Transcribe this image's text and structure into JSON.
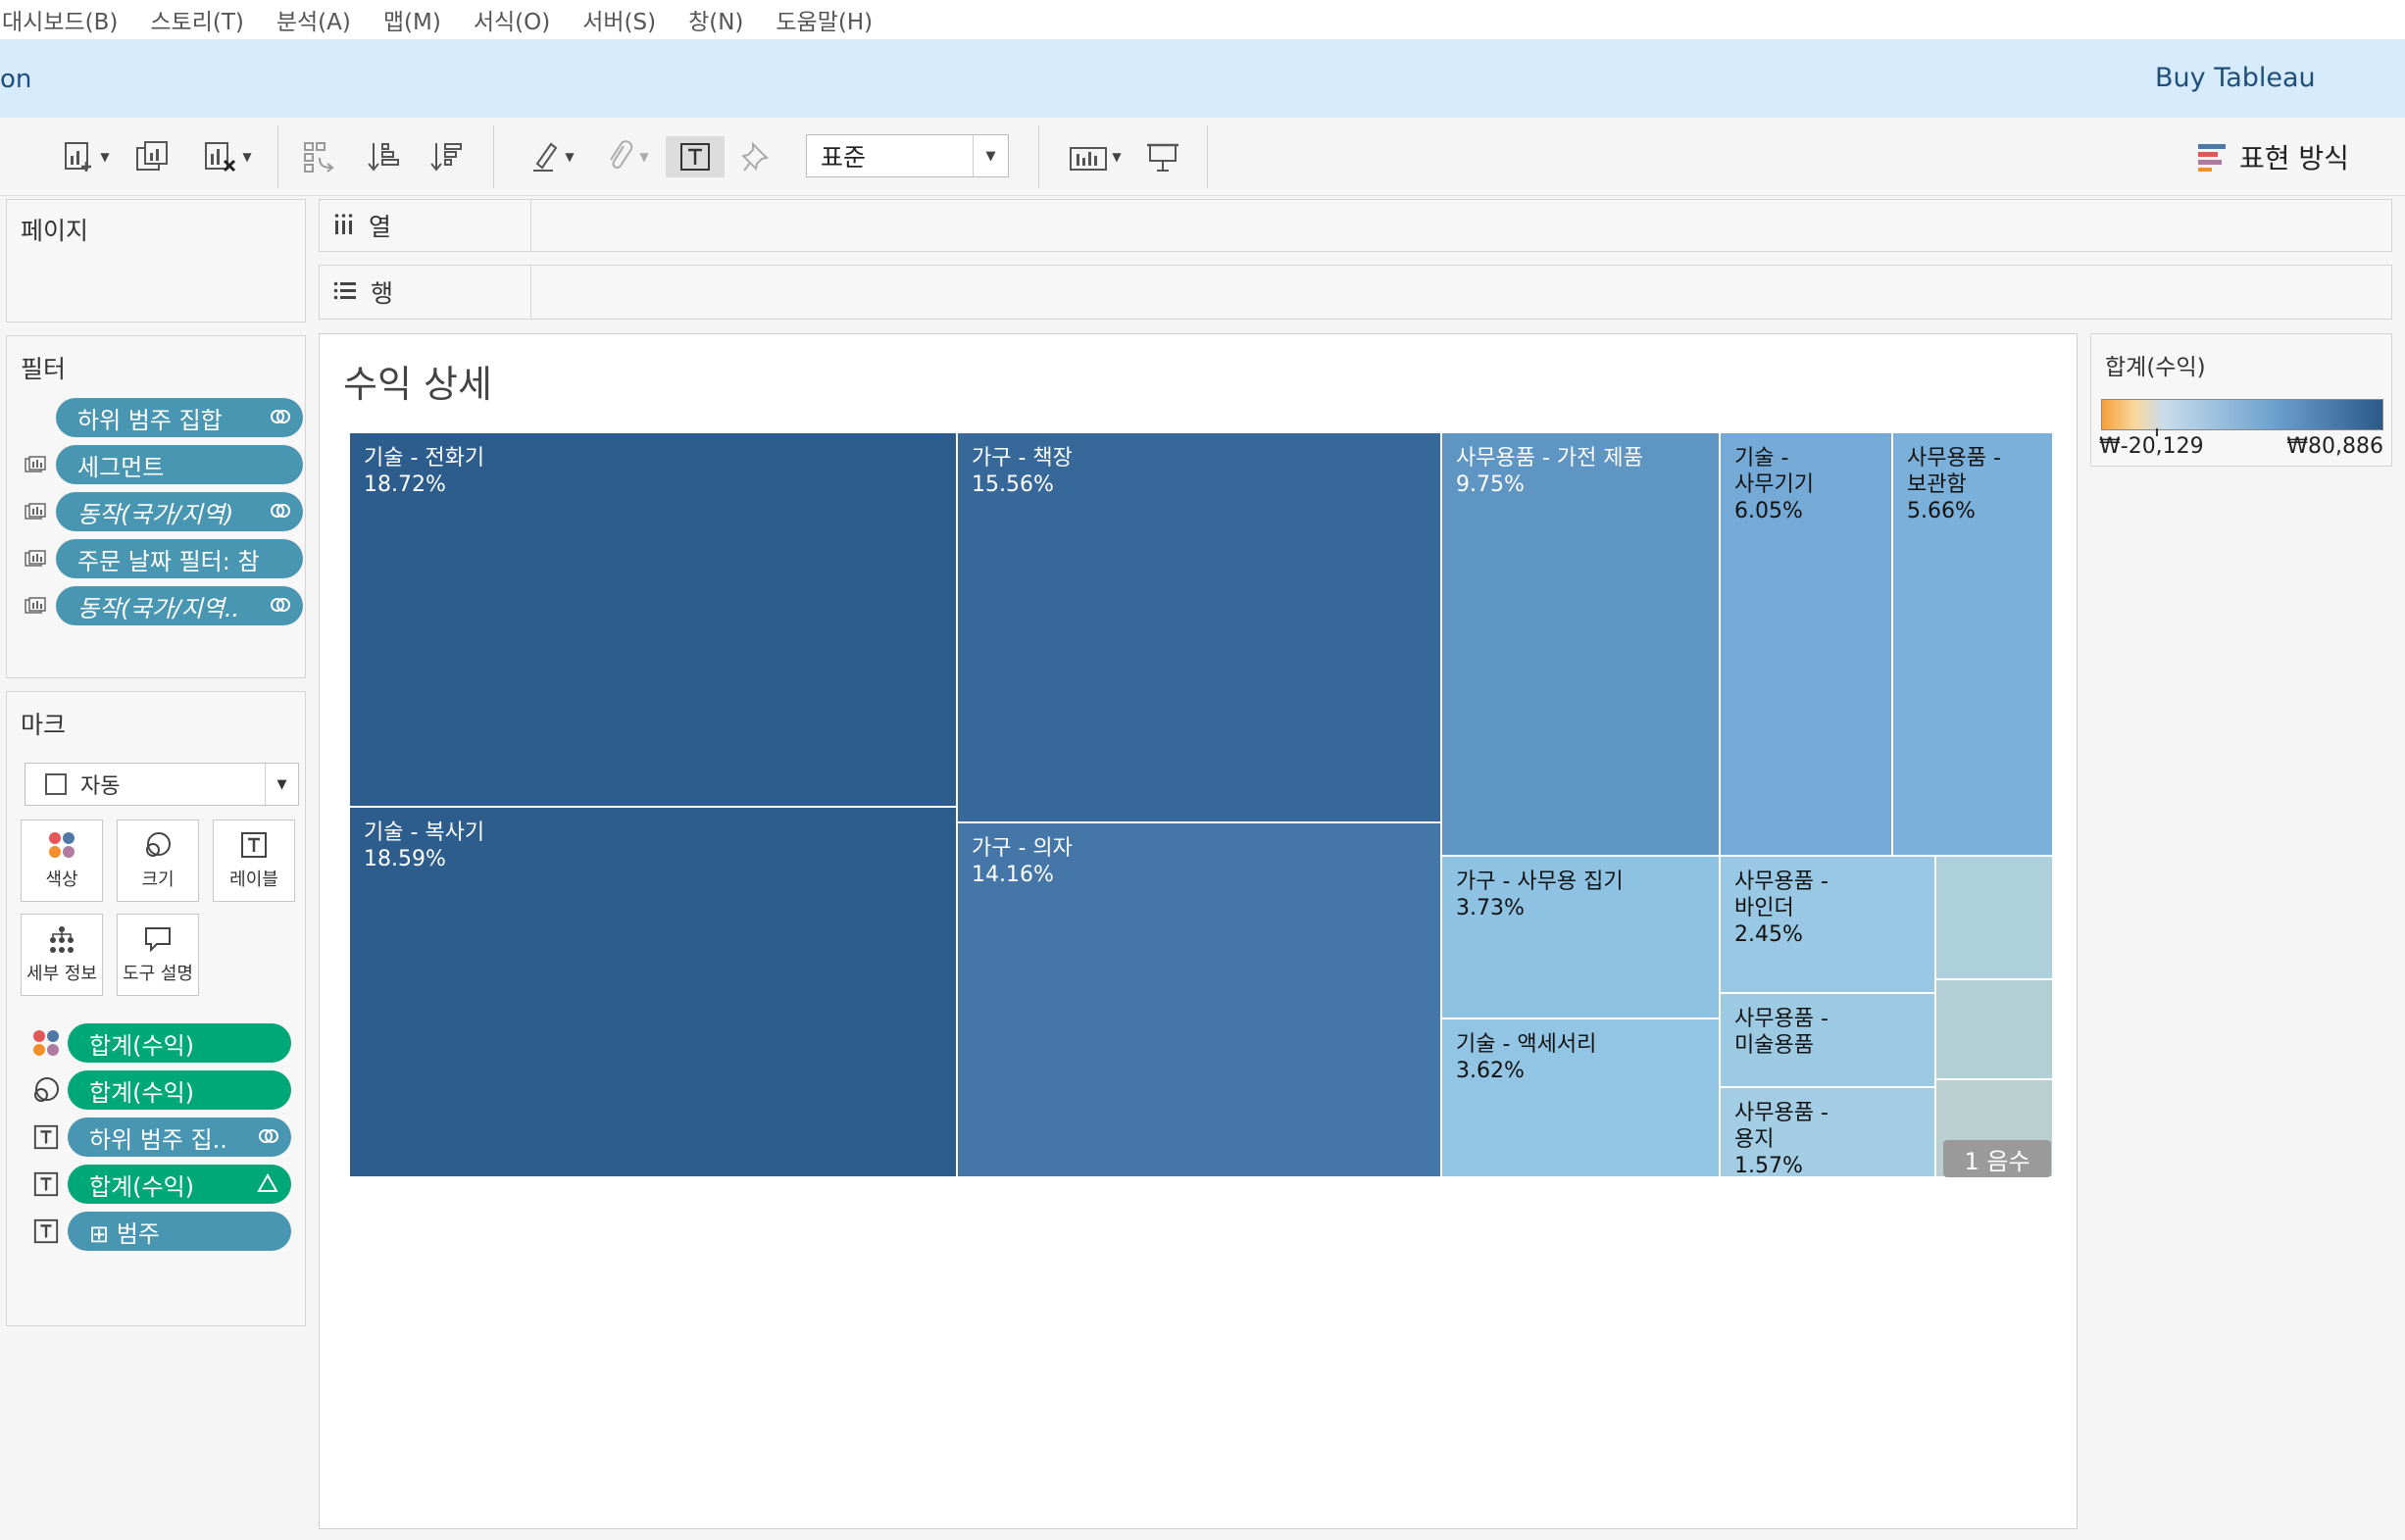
{
  "menu": [
    "대시보드(B)",
    "스토리(T)",
    "분석(A)",
    "맵(M)",
    "서식(O)",
    "서버(S)",
    "창(N)",
    "도움말(H)"
  ],
  "banner": {
    "title_fragment": "on",
    "buy": "Buy Tableau"
  },
  "toolbar": {
    "fit_value": "표준",
    "show_me": "표현 방식"
  },
  "pages": {
    "title": "페이지"
  },
  "columns": {
    "label": "열"
  },
  "rows": {
    "label": "행"
  },
  "filters": {
    "title": "필터",
    "items": [
      {
        "label": "하위 범주 집합",
        "italic": false,
        "icon": "set-icon"
      },
      {
        "label": "세그먼트",
        "italic": false,
        "icon": ""
      },
      {
        "label": "동작(국가/지역)",
        "italic": true,
        "icon": "set-icon"
      },
      {
        "label": "주문 날짜 필터: 참",
        "italic": false,
        "icon": ""
      },
      {
        "label": "동작(국가/지역..",
        "italic": true,
        "icon": "set-icon"
      }
    ]
  },
  "marks": {
    "title": "마크",
    "type": "자동",
    "buttons": [
      "색상",
      "크기",
      "레이블",
      "세부 정보",
      "도구 설명"
    ],
    "pills": [
      {
        "kind": "color",
        "label": "합계(수익)",
        "color": "green",
        "icon": ""
      },
      {
        "kind": "size",
        "label": "합계(수익)",
        "color": "green",
        "icon": ""
      },
      {
        "kind": "label",
        "label": "하위 범주 집..",
        "color": "blue",
        "icon": "set-icon"
      },
      {
        "kind": "label",
        "label": "합계(수익)",
        "color": "green",
        "icon": "delta-icon"
      },
      {
        "kind": "label",
        "label": "⊞ 범주",
        "color": "blue",
        "icon": ""
      }
    ]
  },
  "viz": {
    "title": "수익 상세",
    "null_badge": "1 음수"
  },
  "legend": {
    "title": "합계(수익)",
    "min": "₩-20,129",
    "max": "₩80,886"
  },
  "colors": {
    "pill_blue": "#4996b2",
    "pill_green": "#00a878",
    "legend_low": "#f6a03a",
    "legend_mid": "#c8dceb",
    "legend_high": "#2b5a89"
  },
  "chart_data": {
    "type": "treemap",
    "title": "수익 상세",
    "measure": "합계(수익)",
    "items": [
      {
        "label": "기술 - 전화기",
        "percent": "18.72%",
        "value": 18.72
      },
      {
        "label": "기술 - 복사기",
        "percent": "18.59%",
        "value": 18.59
      },
      {
        "label": "가구 - 책장",
        "percent": "15.56%",
        "value": 15.56
      },
      {
        "label": "가구 - 의자",
        "percent": "14.16%",
        "value": 14.16
      },
      {
        "label": "사무용품 - 가전 제품",
        "percent": "9.75%",
        "value": 9.75
      },
      {
        "label": "기술 - 사무기기",
        "percent": "6.05%",
        "value": 6.05
      },
      {
        "label": "사무용품 - 보관함",
        "percent": "5.66%",
        "value": 5.66
      },
      {
        "label": "가구 - 사무용 집기",
        "percent": "3.73%",
        "value": 3.73
      },
      {
        "label": "기술 - 액세서리",
        "percent": "3.62%",
        "value": 3.62
      },
      {
        "label": "사무용품 - 바인더",
        "percent": "2.45%",
        "value": 2.45
      },
      {
        "label": "사무용품 - 미술용품",
        "percent": "",
        "value": null
      },
      {
        "label": "사무용품 - 용지",
        "percent": "1.57%",
        "value": 1.57
      },
      {
        "label": "",
        "percent": "",
        "value": null
      },
      {
        "label": "",
        "percent": "",
        "value": null
      },
      {
        "label": "",
        "percent": "",
        "value": null
      }
    ]
  }
}
